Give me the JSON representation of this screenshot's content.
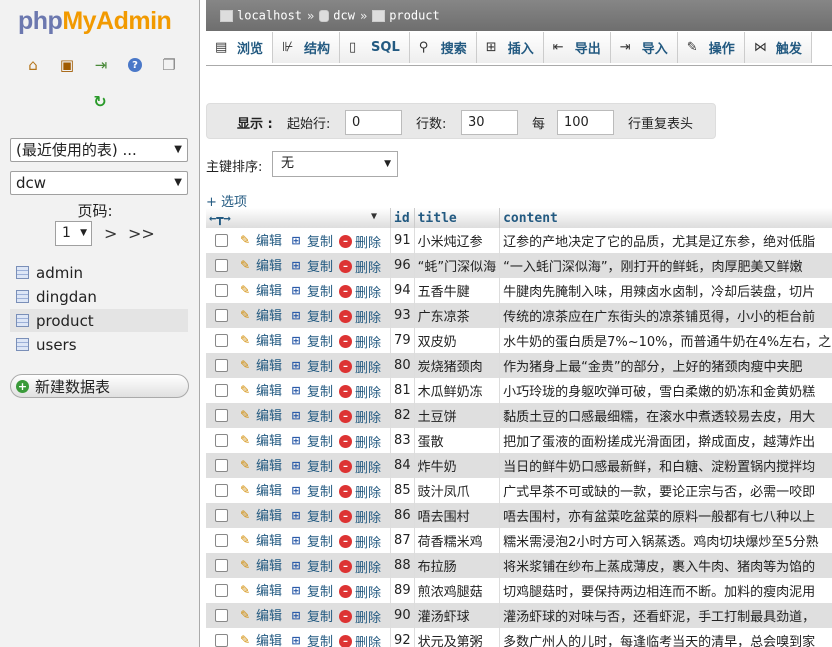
{
  "nav": {
    "logo_php": "php",
    "logo_myadmin": "MyAdmin",
    "recent_select": "(最近使用的表) ...",
    "db_select": "dcw",
    "page_label": "页码:",
    "page_value": "1",
    "page_next": ">",
    "page_last": ">>",
    "tables": [
      {
        "label": "admin"
      },
      {
        "label": "dingdan"
      },
      {
        "label": "product"
      },
      {
        "label": "users"
      }
    ],
    "new_db_label": "新建数据表"
  },
  "breadcrumb": {
    "server": "localhost",
    "database": "dcw",
    "table": "product",
    "separator": "»"
  },
  "tabs": [
    {
      "label": "浏览",
      "icon": "browse-icon"
    },
    {
      "label": "结构",
      "icon": "structure-icon"
    },
    {
      "label": "SQL",
      "icon": "sql-icon"
    },
    {
      "label": "搜索",
      "icon": "search-icon"
    },
    {
      "label": "插入",
      "icon": "insert-icon"
    },
    {
      "label": "导出",
      "icon": "export-icon"
    },
    {
      "label": "导入",
      "icon": "import-icon"
    },
    {
      "label": "操作",
      "icon": "operations-icon"
    },
    {
      "label": "触发",
      "icon": "triggers-icon"
    }
  ],
  "controls": {
    "show_label": "显示 :",
    "start_label": "起始行:",
    "start_value": "0",
    "rows_label": "行数:",
    "rows_value": "30",
    "every_label": "每",
    "every_value": "100",
    "repeat_label": "行重复表头"
  },
  "sort": {
    "label": "主键排序:",
    "value": "无"
  },
  "options_link": "+ 选项",
  "table": {
    "columns": [
      "id",
      "title",
      "content"
    ],
    "actions": {
      "edit": "编辑",
      "copy": "复制",
      "delete": "删除"
    },
    "rows": [
      {
        "id": "91",
        "title": "小米炖辽参",
        "content": "辽参的产地决定了它的品质，尤其是辽东参，绝对低脂"
      },
      {
        "id": "96",
        "title": "“蚝”门深似海",
        "content": "“一入蚝门深似海”，刚打开的鲜蚝，肉厚肥美又鲜嫩"
      },
      {
        "id": "94",
        "title": "五香牛腱",
        "content": "牛腱肉先腌制入味，用辣卤水卤制，冷却后装盘，切片"
      },
      {
        "id": "93",
        "title": "广东凉茶",
        "content": "传统的凉茶应在广东街头的凉茶铺觅得，小小的柜台前"
      },
      {
        "id": "79",
        "title": "双皮奶",
        "content": "水牛奶的蛋白质是7%~10%，而普通牛奶在4%左右，之"
      },
      {
        "id": "80",
        "title": "炭烧猪颈肉",
        "content": "作为猪身上最“金贵”的部分，上好的猪颈肉瘦中夹肥"
      },
      {
        "id": "81",
        "title": "木瓜鲜奶冻",
        "content": "小巧玲珑的身躯吹弹可破，雪白柔嫩的奶冻和金黄奶糕"
      },
      {
        "id": "82",
        "title": "土豆饼",
        "content": "黏质土豆的口感最细糯，在滚水中煮透较易去皮，用大"
      },
      {
        "id": "83",
        "title": "蛋散",
        "content": "把加了蛋液的面粉搓成光滑面团，擀成面皮，越薄炸出"
      },
      {
        "id": "84",
        "title": "炸牛奶",
        "content": "当日的鲜牛奶口感最新鲜，和白糖、淀粉置锅内搅拌均"
      },
      {
        "id": "85",
        "title": "豉汁凤爪",
        "content": "广式早茶不可或缺的一款，要论正宗与否，必需一咬即"
      },
      {
        "id": "86",
        "title": "唔去围村",
        "content": "唔去围村，亦有盆菜吃盆菜的原料一般都有七八种以上"
      },
      {
        "id": "87",
        "title": "荷香糯米鸡",
        "content": "糯米需浸泡2小时方可入锅蒸透。鸡肉切块爆炒至5分熟"
      },
      {
        "id": "88",
        "title": "布拉肠",
        "content": "将米浆铺在纱布上蒸成薄皮，裹入牛肉、猪肉等为馅的"
      },
      {
        "id": "89",
        "title": "煎浓鸡腿菇",
        "content": "切鸡腿菇时，要保持两边相连而不断。加料的瘦肉泥用"
      },
      {
        "id": "90",
        "title": "灌汤虾球",
        "content": "灌汤虾球的对味与否，还看虾泥，手工打制最具劲道，"
      },
      {
        "id": "92",
        "title": "状元及第粥",
        "content": "多数广州人的儿时，每逢临考当天的清早，总会嗅到家"
      }
    ]
  },
  "colors": {
    "link": "#235a81",
    "logo_php": "#6c78af",
    "logo_myadmin": "#f29a00",
    "crumb_bg": "#767676"
  }
}
